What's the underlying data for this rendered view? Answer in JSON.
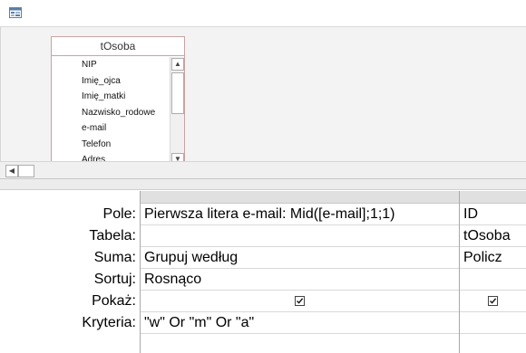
{
  "query_icon": "query-design-icon",
  "table_box": {
    "title": "tOsoba",
    "fields": [
      "NIP",
      "Imię_ojca",
      "Imię_matki",
      "Nazwisko_rodowe",
      "e-mail",
      "Telefon",
      "Adres"
    ]
  },
  "grid": {
    "row_labels": {
      "field": "Pole:",
      "table": "Tabela:",
      "total": "Suma:",
      "sort": "Sortuj:",
      "show": "Pokaż:",
      "criteria": "Kryteria:"
    },
    "columns": [
      {
        "field": "Pierwsza litera e-mail: Mid([e-mail];1;1)",
        "table": "",
        "total": "Grupuj według",
        "sort": "Rosnąco",
        "show": true,
        "criteria": "\"w\" Or \"m\" Or \"a\""
      },
      {
        "field": "ID",
        "table": "tOsoba",
        "total": "Policz",
        "sort": "",
        "show": true,
        "criteria": ""
      }
    ]
  }
}
